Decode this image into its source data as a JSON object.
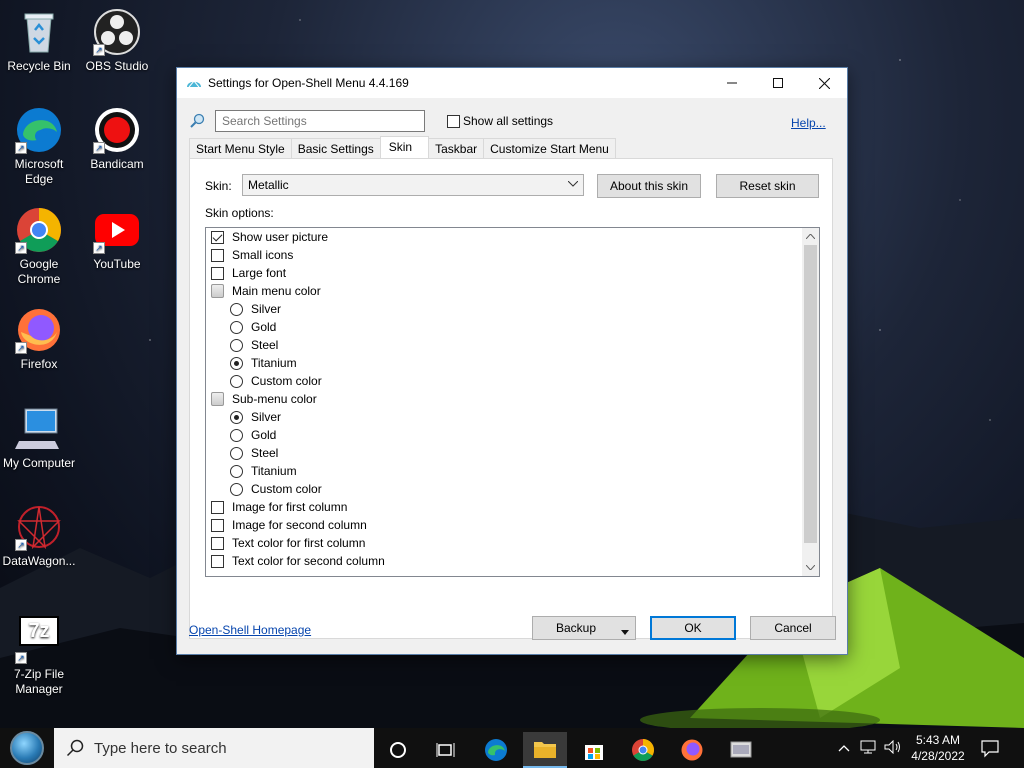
{
  "desktop": {
    "icons": [
      {
        "label": "Recycle Bin"
      },
      {
        "label": "OBS Studio"
      },
      {
        "label": "Microsoft Edge"
      },
      {
        "label": "Bandicam"
      },
      {
        "label": "Google Chrome"
      },
      {
        "label": "YouTube"
      },
      {
        "label": "Firefox"
      },
      {
        "label": "My Computer"
      },
      {
        "label": "DataWagon..."
      },
      {
        "label": "7-Zip File Manager"
      }
    ],
    "zip_glyph": "7z"
  },
  "dialog": {
    "title": "Settings for Open-Shell Menu 4.4.169",
    "search_placeholder": "Search Settings",
    "show_all_label": "Show all settings",
    "help_link": "Help...",
    "tabs": [
      {
        "label": "Start Menu Style"
      },
      {
        "label": "Basic Settings"
      },
      {
        "label": "Skin"
      },
      {
        "label": "Taskbar"
      },
      {
        "label": "Customize Start Menu"
      }
    ],
    "skin_label": "Skin:",
    "skin_value": "Metallic",
    "about_skin_button": "About this skin",
    "reset_skin_button": "Reset skin",
    "skin_options_label": "Skin options:",
    "options": [
      {
        "label": "Show user picture"
      },
      {
        "label": "Small icons"
      },
      {
        "label": "Large font"
      },
      {
        "label": "Main menu color"
      },
      {
        "label": "Silver"
      },
      {
        "label": "Gold"
      },
      {
        "label": "Steel"
      },
      {
        "label": "Titanium"
      },
      {
        "label": "Custom color"
      },
      {
        "label": "Sub-menu color"
      },
      {
        "label": "Silver"
      },
      {
        "label": "Gold"
      },
      {
        "label": "Steel"
      },
      {
        "label": "Titanium"
      },
      {
        "label": "Custom color"
      },
      {
        "label": "Image for first column"
      },
      {
        "label": "Image for second column"
      },
      {
        "label": "Text color for first column"
      },
      {
        "label": "Text color for second column"
      }
    ],
    "homepage_link": "Open-Shell Homepage",
    "backup_button": "Backup",
    "ok_button": "OK",
    "cancel_button": "Cancel"
  },
  "taskbar": {
    "search_placeholder": "Type here to search",
    "time": "5:43 AM",
    "date": "4/28/2022"
  },
  "colors": {
    "accent": "#0078d7",
    "link": "#0645ad",
    "taskbar": "#101010"
  }
}
